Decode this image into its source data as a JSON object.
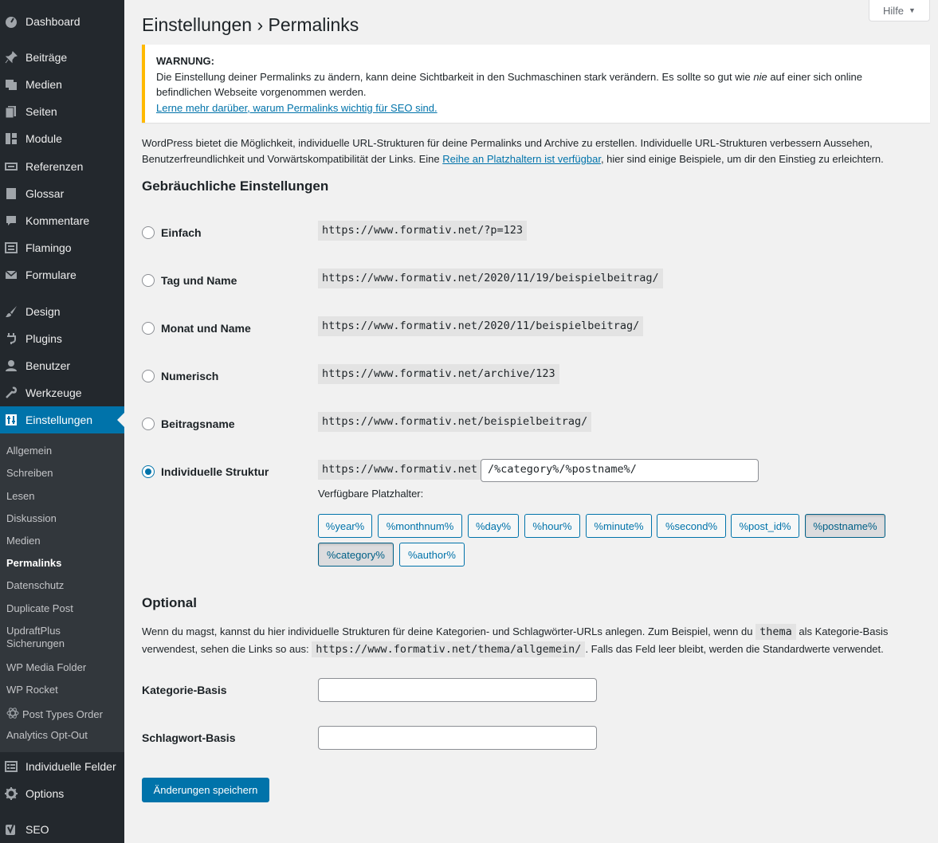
{
  "sidebar": {
    "items": [
      {
        "label": "Dashboard",
        "icon": "dashboard-icon"
      },
      {
        "label": "Beiträge",
        "icon": "pin-icon"
      },
      {
        "label": "Medien",
        "icon": "media-icon"
      },
      {
        "label": "Seiten",
        "icon": "pages-icon"
      },
      {
        "label": "Module",
        "icon": "modules-icon"
      },
      {
        "label": "Referenzen",
        "icon": "references-icon"
      },
      {
        "label": "Glossar",
        "icon": "book-icon"
      },
      {
        "label": "Kommentare",
        "icon": "comment-icon"
      },
      {
        "label": "Flamingo",
        "icon": "flamingo-icon"
      },
      {
        "label": "Formulare",
        "icon": "mail-icon"
      },
      {
        "label": "Design",
        "icon": "brush-icon"
      },
      {
        "label": "Plugins",
        "icon": "plugin-icon"
      },
      {
        "label": "Benutzer",
        "icon": "user-icon"
      },
      {
        "label": "Werkzeuge",
        "icon": "wrench-icon"
      },
      {
        "label": "Einstellungen",
        "icon": "settings-icon"
      },
      {
        "label": "Individuelle Felder",
        "icon": "fields-icon"
      },
      {
        "label": "Options",
        "icon": "gear-icon"
      },
      {
        "label": "SEO",
        "icon": "yoast-icon"
      }
    ],
    "submenu": [
      "Allgemein",
      "Schreiben",
      "Lesen",
      "Diskussion",
      "Medien",
      "Permalinks",
      "Datenschutz",
      "Duplicate Post",
      "UpdraftPlus Sicherungen",
      "WP Media Folder",
      "WP Rocket",
      "Post Types Order",
      "Analytics Opt-Out"
    ]
  },
  "header": {
    "help": "Hilfe",
    "title": "Einstellungen › Permalinks"
  },
  "warning": {
    "title": "WARNUNG:",
    "text_before": "Die Einstellung deiner Permalinks zu ändern, kann deine Sichtbarkeit in den Suchmaschinen stark verändern. Es sollte so gut wie ",
    "emph": "nie",
    "text_after": " auf einer sich online befindlichen Webseite vorgenommen werden.",
    "link": "Lerne mehr darüber, warum Permalinks wichtig für SEO sind."
  },
  "intro": {
    "before": "WordPress bietet die Möglichkeit, individuelle URL-Strukturen für deine Permalinks und Archive zu erstellen. Individuelle URL-Strukturen verbessern Aussehen, Benutzerfreundlichkeit und Vorwärtskompatibilität der Links. Eine ",
    "link": "Reihe an Platzhaltern ist verfügbar",
    "after": ", hier sind einige Beispiele, um dir den Einstieg zu erleichtern."
  },
  "common": {
    "heading": "Gebräuchliche Einstellungen",
    "options": [
      {
        "label": "Einfach",
        "url": "https://www.formativ.net/?p=123"
      },
      {
        "label": "Tag und Name",
        "url": "https://www.formativ.net/2020/11/19/beispielbeitrag/"
      },
      {
        "label": "Monat und Name",
        "url": "https://www.formativ.net/2020/11/beispielbeitrag/"
      },
      {
        "label": "Numerisch",
        "url": "https://www.formativ.net/archive/123"
      },
      {
        "label": "Beitragsname",
        "url": "https://www.formativ.net/beispielbeitrag/"
      },
      {
        "label": "Individuelle Struktur",
        "url": "https://www.formativ.net"
      }
    ],
    "custom_value": "/%category%/%postname%/",
    "available_label": "Verfügbare Platzhalter:",
    "tags": [
      "%year%",
      "%monthnum%",
      "%day%",
      "%hour%",
      "%minute%",
      "%second%",
      "%post_id%",
      "%postname%",
      "%category%",
      "%author%"
    ]
  },
  "optional": {
    "heading": "Optional",
    "desc1": "Wenn du magst, kannst du hier individuelle Strukturen für deine Kategorien- und Schlagwörter-URLs anlegen. Zum Beispiel, wenn du ",
    "code1": "thema",
    "desc2": " als Kategorie-Basis verwendest, sehen die Links so aus: ",
    "code2": "https://www.formativ.net/thema/allgemein/",
    "desc3": ". Falls das Feld leer bleibt, werden die Standardwerte verwendet.",
    "category_label": "Kategorie-Basis",
    "tag_label": "Schlagwort-Basis"
  },
  "save_label": "Änderungen speichern"
}
